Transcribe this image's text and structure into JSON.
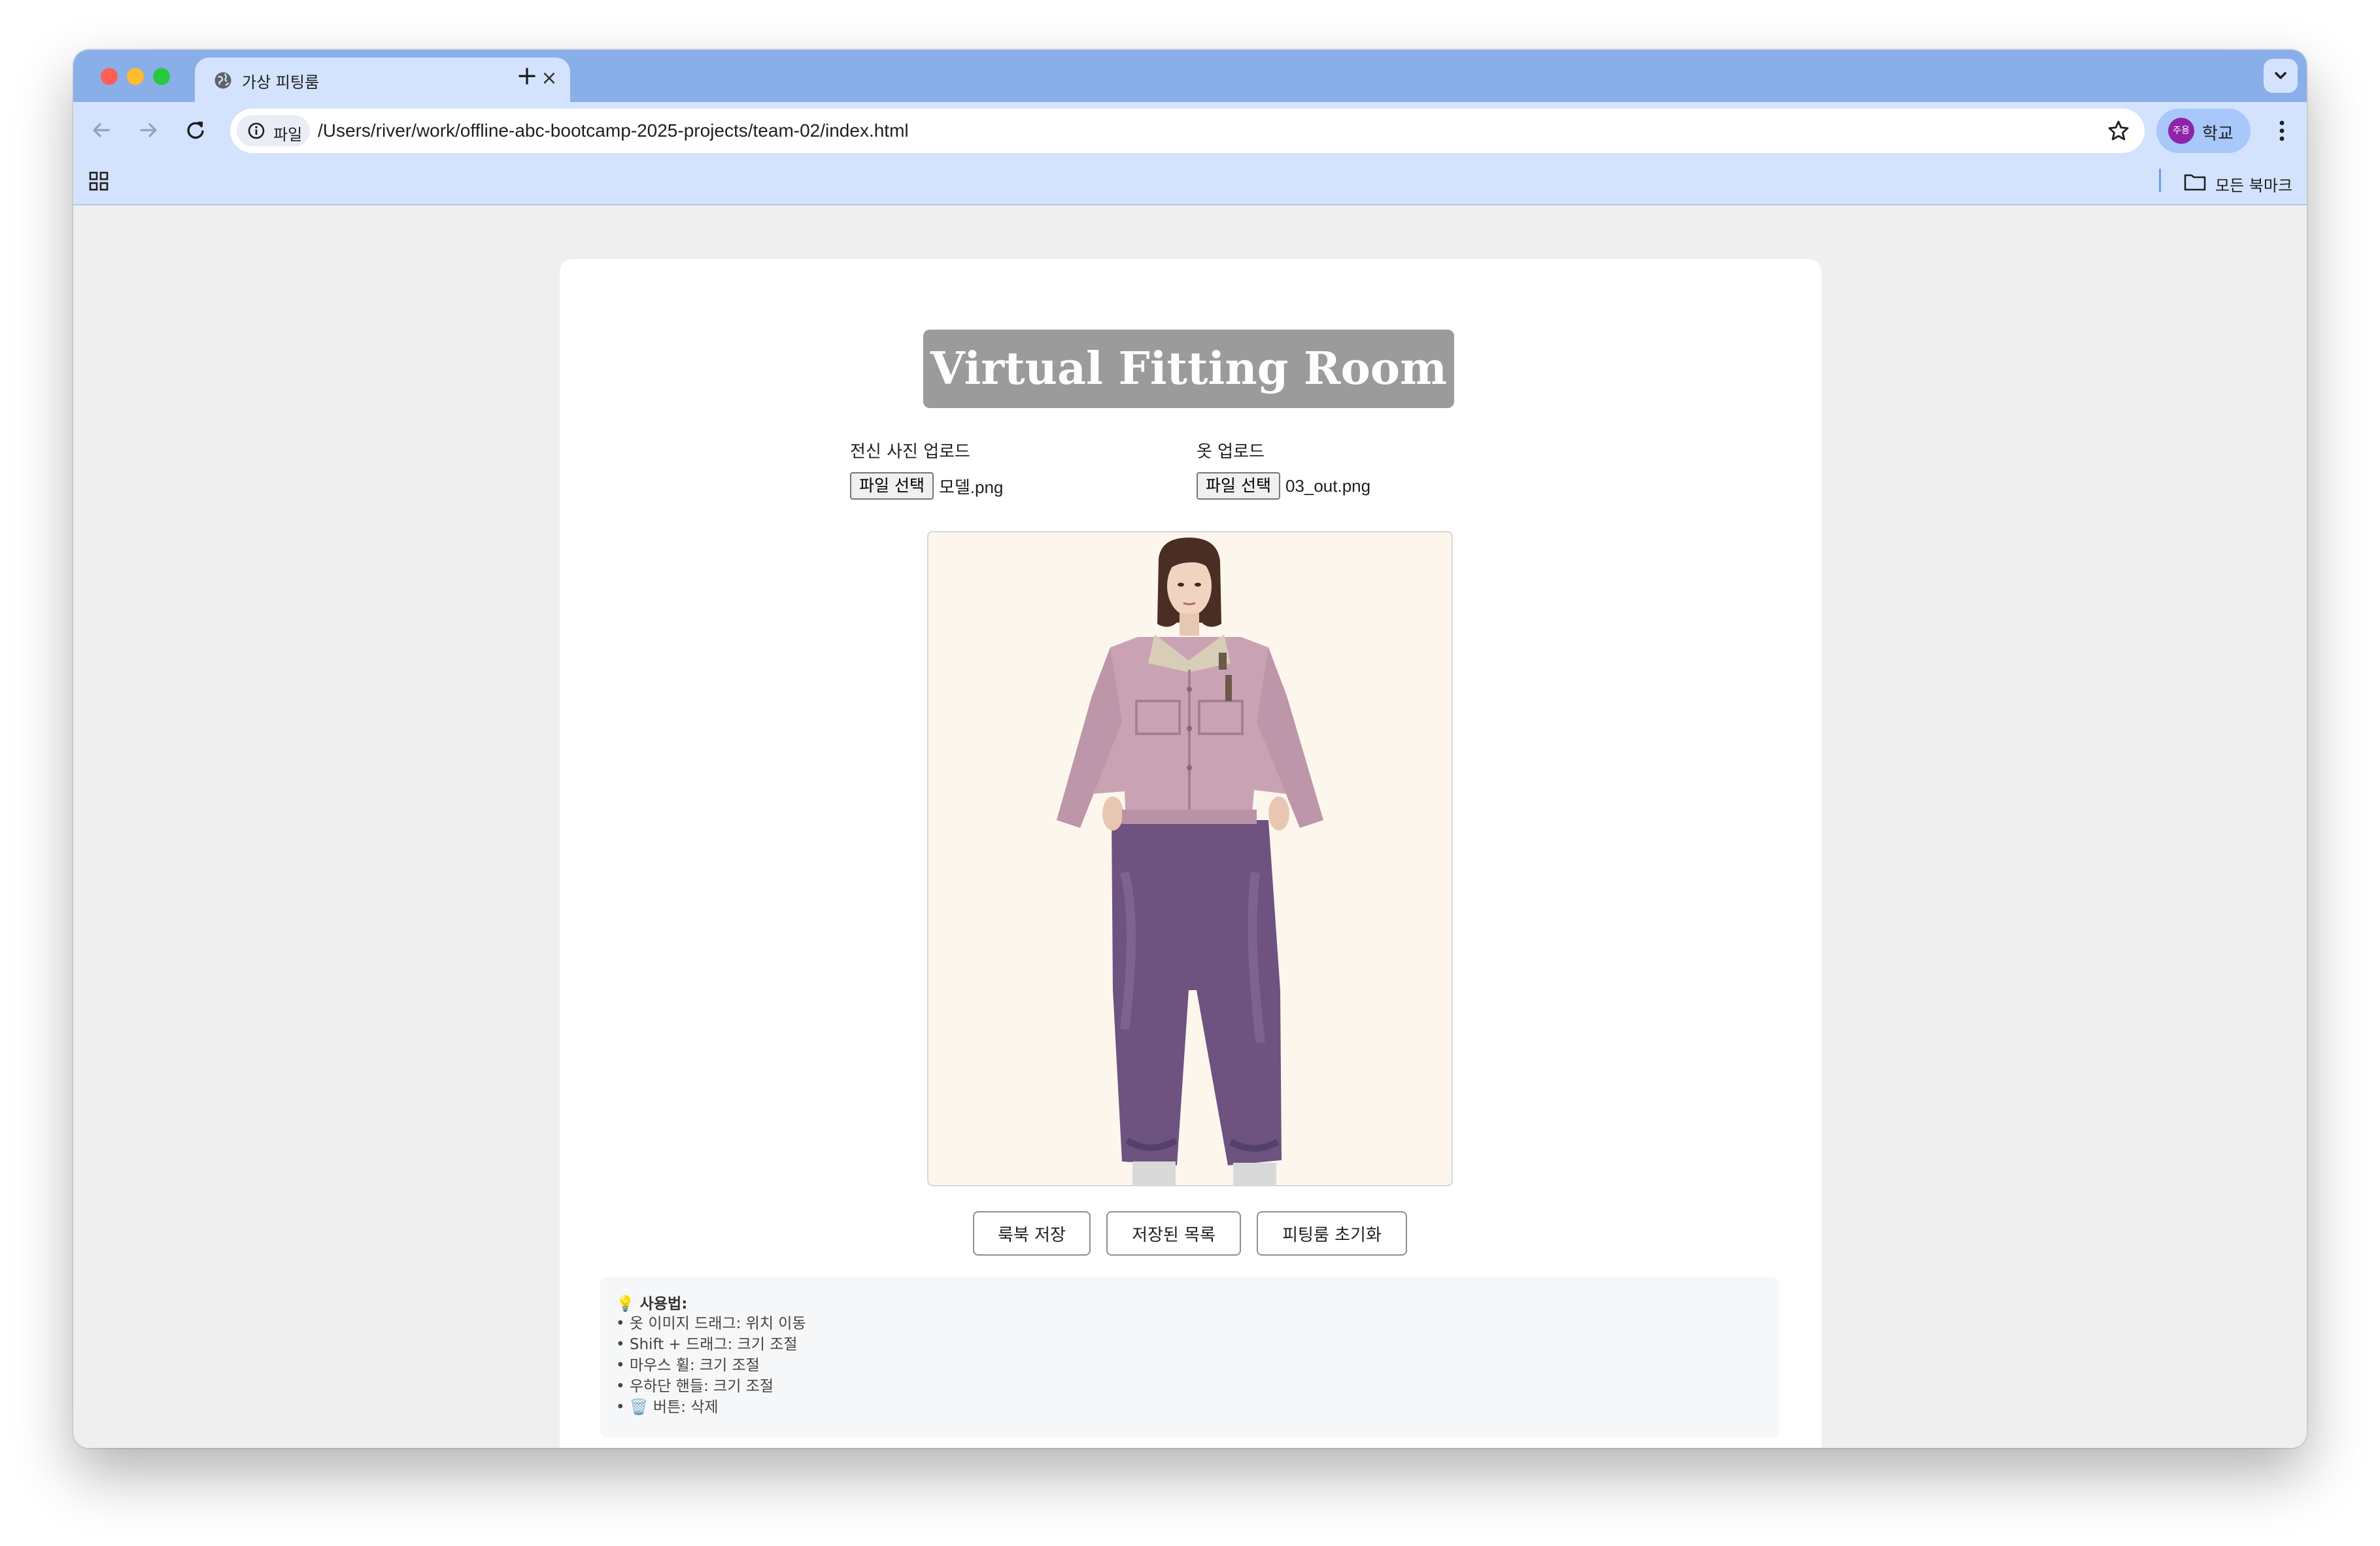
{
  "browser": {
    "tab_title": "가상 피팅룸",
    "new_tab": "+",
    "tab_close": "×",
    "site_chip": "파일",
    "url": "/Users/river/work/offline-abc-bootcamp-2025-projects/team-02/index.html",
    "profile_badge": "주용",
    "profile_label": "학교",
    "all_bookmarks": "모든 북마크"
  },
  "page": {
    "title": "Virtual Fitting Room",
    "model_upload": {
      "label": "전신 사진 업로드",
      "button": "파일 선택",
      "file_name": "모델.png"
    },
    "cloth_upload": {
      "label": "옷 업로드",
      "button": "파일 선택",
      "file_name": "03_out.png"
    },
    "actions": {
      "save": "룩북 저장",
      "saved_list": "저장된 목록",
      "reset": "피팅룸 초기화"
    },
    "help": {
      "title": "💡 사용법:",
      "lines": [
        "• 옷 이미지 드래그: 위치 이동",
        "• Shift + 드래그: 크기 조절",
        "• 마우스 휠: 크기 조절",
        "• 우하단 핸들: 크기 조절",
        "• 🗑️ 버튼: 삭제"
      ]
    }
  },
  "colors": {
    "tab_strip": "#8aaee8",
    "toolbar": "#d3e3fd",
    "title_box": "#9b9b9b",
    "stage_bg": "#fdf6ec",
    "jacket": "#c9a3b4",
    "pants": "#6e527f"
  }
}
